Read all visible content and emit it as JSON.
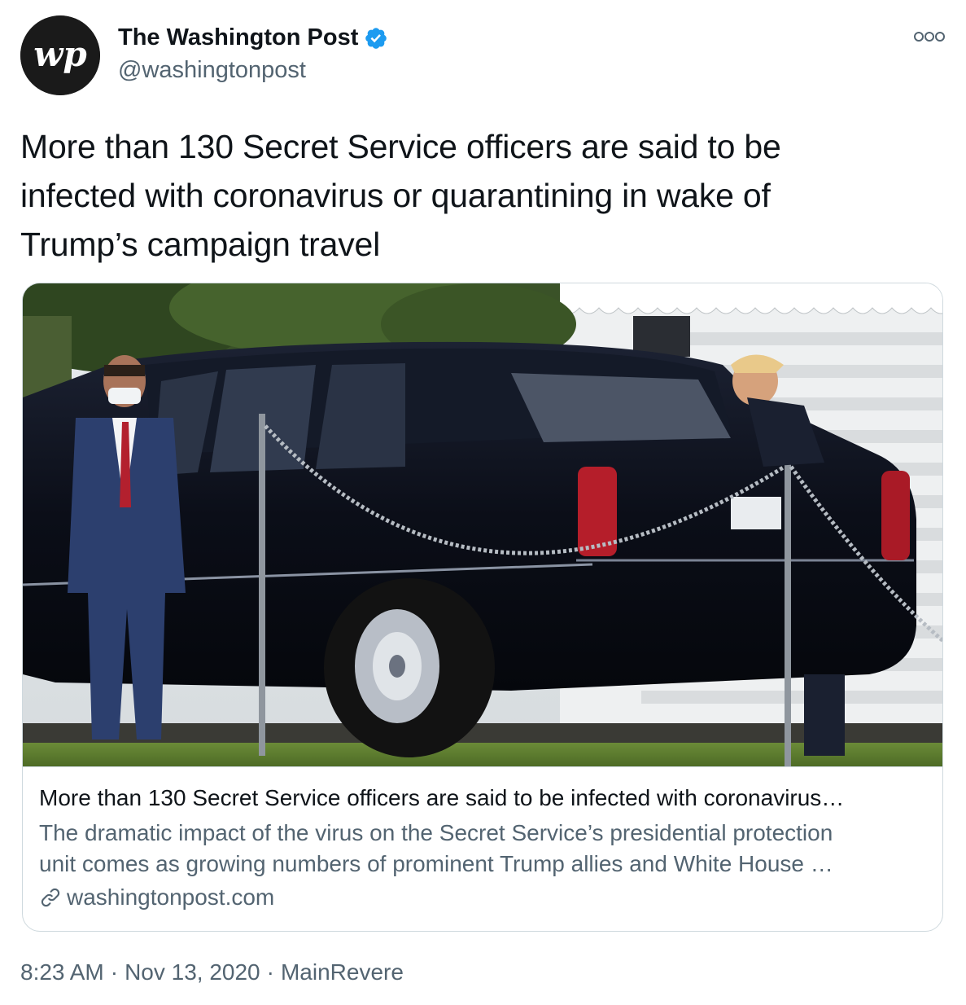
{
  "author": {
    "name": "The Washington Post",
    "handle": "@washingtonpost",
    "verified": true,
    "avatar_text": "wp"
  },
  "tweet": {
    "text_lines": [
      "More than 130 Secret Service officers are said to be",
      "infected with coronavirus or quarantining in wake of",
      "Trump’s campaign travel"
    ]
  },
  "card": {
    "image_alt": "Secret Service agent in a mask standing beside the presidential limousine while President Trump walks behind it near the White House",
    "title": "More than 130 Secret Service officers are said to be infected with coronavirus…",
    "description_lines": [
      "The dramatic impact of the virus on the Secret Service’s presidential protection",
      "unit comes as growing numbers of prominent Trump allies and White House …"
    ],
    "domain": "washingtonpost.com"
  },
  "meta": {
    "time": "8:23 AM",
    "date": "Nov 13, 2020",
    "source": "MainRevere",
    "separator": "·"
  },
  "colors": {
    "text_primary": "#0f1419",
    "text_secondary": "#536471",
    "verified_blue": "#1d9bf0",
    "border": "#cfd9de"
  },
  "icons": {
    "more": "more-horizontal-icon",
    "verified": "verified-badge-icon",
    "link": "link-icon"
  }
}
